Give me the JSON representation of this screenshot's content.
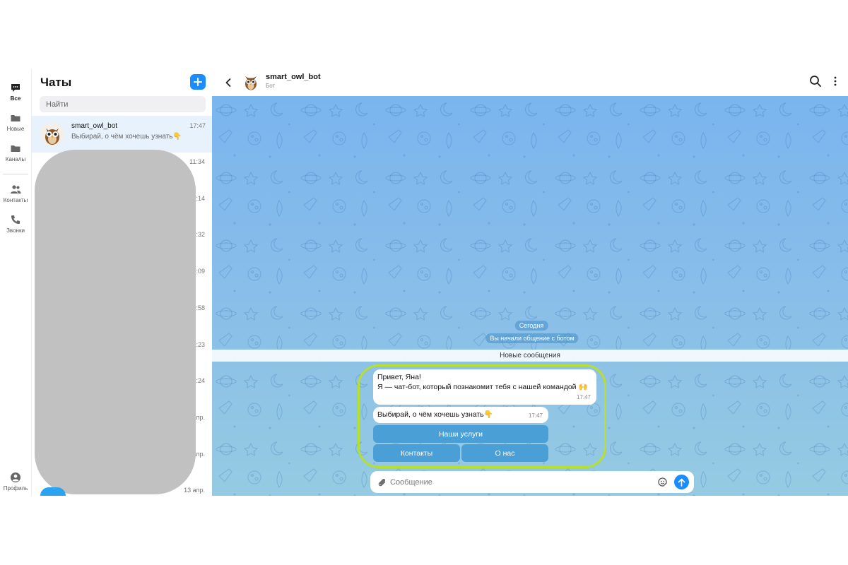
{
  "rail": {
    "items": [
      {
        "label": "Все",
        "icon": "chat-bubble-icon",
        "active": true
      },
      {
        "label": "Новые",
        "icon": "folder-icon"
      },
      {
        "label": "Каналы",
        "icon": "folder-icon"
      },
      {
        "label": "Контакты",
        "icon": "contacts-icon"
      },
      {
        "label": "Звонки",
        "icon": "phone-icon"
      }
    ],
    "profile": {
      "label": "Профиль",
      "icon": "profile-icon"
    }
  },
  "chatlist": {
    "title": "Чаты",
    "search_placeholder": "Найти",
    "chats": [
      {
        "name": "smart_owl_bot",
        "preview": "Выбирай, о чём хочешь узнать👇",
        "time": "17:47"
      }
    ],
    "times": [
      "11:34",
      "6:14",
      "1:32",
      "1:09",
      "0:58",
      "0:23",
      "3:24",
      "апр.",
      "апр.",
      "13 апр."
    ]
  },
  "conversation": {
    "name": "smart_owl_bot",
    "subtitle": "Бот",
    "date_pill": "Сегодня",
    "service_pill": "Вы начали общение с ботом",
    "new_messages": "Новые сообщения",
    "messages": [
      {
        "line1": "Привет, Яна!",
        "line2": "Я — чат-бот, который познакомит тебя с нашей командой 🙌",
        "time": "17:47"
      },
      {
        "text": "Выбирай, о чём хочешь узнать👇",
        "time": "17:47"
      }
    ],
    "keyboard": {
      "row1": [
        "Наши услуги"
      ],
      "row2": [
        "Контакты",
        "О нас"
      ]
    },
    "composer_placeholder": "Сообщение"
  },
  "colors": {
    "accent": "#1a8cff",
    "active_chat_bg": "#e7f2fd",
    "keyboard_button": "#4a9fd6",
    "highlight_outline": "#b6e02a"
  }
}
